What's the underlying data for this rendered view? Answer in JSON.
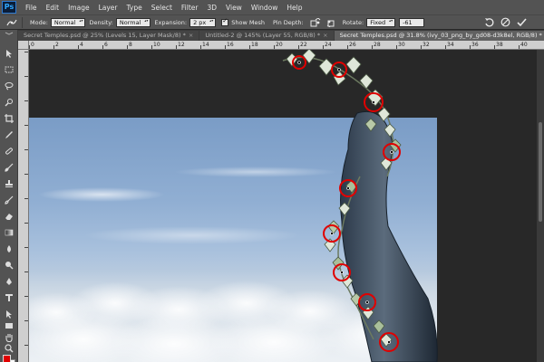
{
  "app": {
    "logo_text": "Ps"
  },
  "menu": {
    "items": [
      "File",
      "Edit",
      "Image",
      "Layer",
      "Type",
      "Select",
      "Filter",
      "3D",
      "View",
      "Window",
      "Help"
    ]
  },
  "options": {
    "mode_label": "Mode:",
    "mode_value": "Normal",
    "density_label": "Density:",
    "density_value": "Normal",
    "expansion_label": "Expansion:",
    "expansion_value": "2 px",
    "show_mesh_label": "Show Mesh",
    "show_mesh_checked": true,
    "pin_depth_label": "Pin Depth:",
    "rotate_label": "Rotate:",
    "rotate_value": "Fixed",
    "rotate_angle": "-61"
  },
  "tabs": [
    {
      "label": "Secret Temples.psd @ 25% (Levels 15, Layer Mask/8) *",
      "active": false
    },
    {
      "label": "Untitled-2 @ 145% (Layer 55, RGB/8) *",
      "active": false
    },
    {
      "label": "Secret Temples.psd @ 31.8% (ivy_03_png_by_gd08-d3k8el, RGB/8) *",
      "active": true
    }
  ],
  "ruler": {
    "top_ticks": [
      "0",
      "2",
      "4",
      "6",
      "8",
      "10",
      "12",
      "14",
      "16",
      "18",
      "20",
      "22",
      "24",
      "26",
      "28",
      "30",
      "32",
      "34",
      "36",
      "38",
      "40"
    ]
  },
  "colors": {
    "foreground": "#e00000",
    "background": "#ffffff",
    "pin_color": "#e00000",
    "accent": "#31a8ff"
  },
  "icons": {
    "toolbar": [
      "move-icon",
      "marquee-icon",
      "lasso-icon",
      "quick-select-icon",
      "crop-icon",
      "eyedropper-icon",
      "healing-brush-icon",
      "brush-icon",
      "clone-stamp-icon",
      "history-brush-icon",
      "eraser-icon",
      "gradient-icon",
      "blur-icon",
      "dodge-icon",
      "pen-icon",
      "type-icon",
      "path-select-icon",
      "shape-icon",
      "hand-icon",
      "zoom-icon"
    ],
    "options_right": [
      "undo-icon",
      "cancel-icon",
      "commit-checkmark-icon"
    ]
  }
}
